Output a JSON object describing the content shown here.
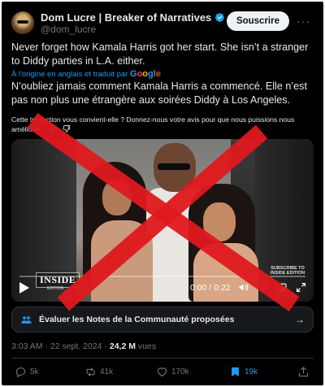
{
  "author": {
    "display_name": "Dom Lucre | Breaker of Narratives",
    "handle": "@dom_lucre",
    "verified": true
  },
  "header": {
    "subscribe_label": "Souscrire",
    "more_icon": "more-dots-icon"
  },
  "tweet": {
    "text": "Never forget how Kamala Harris got her start. She isn’t a stranger to Diddy parties in L.A. either.",
    "translated_by": "À l'origine en anglais et traduit par",
    "translator": "Google",
    "translated_text": "N’oubliez jamais comment Kamala Harris a commencé. Elle n’est pas non plus une étrangère aux soirées Diddy à Los Angeles.",
    "feedback_prompt": "Cette traduction vous convient-elle ? Donnez-nous votre avis pour que nous puissions nous améliorer :"
  },
  "video": {
    "time": "0:00 / 0:22",
    "progress": 0.0,
    "watermark": "INSIDE",
    "watermark_sub": "EDITION",
    "corner_mark": "SUBSCRIBE TO INSIDE EDITION",
    "overlay": "red-x-cross",
    "overlay_color": "#e0191e"
  },
  "community_notes": {
    "label": "Évaluer les Notes de la Communauté proposées"
  },
  "meta": {
    "time": "3:03 AM",
    "date": "22 sept. 2024",
    "views_count": "24,2 M",
    "views_label": "vues",
    "separator": "·"
  },
  "actions": {
    "replies": "5k",
    "reposts": "41k",
    "likes": "170k",
    "bookmarks": "19k"
  },
  "colors": {
    "background": "#000000",
    "accent": "#1d9bf0",
    "secondary_text": "#71767b"
  }
}
